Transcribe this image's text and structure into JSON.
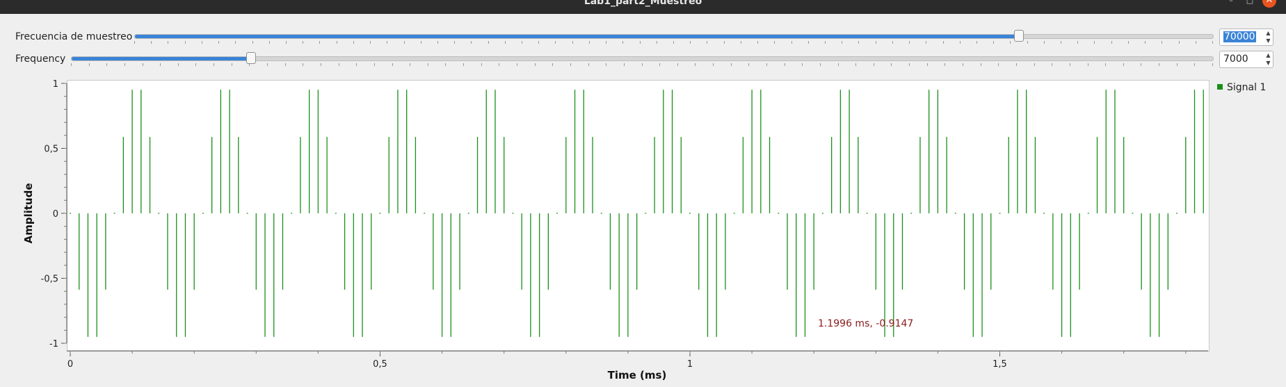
{
  "window": {
    "title": "Lab1_part2_Muestreo",
    "min_icon": "minimize-icon",
    "max_icon": "maximize-icon",
    "close_icon": "close-icon"
  },
  "controls": [
    {
      "label": "Frecuencia de muestreo",
      "value": "70000",
      "selected": true,
      "fraction": 0.82
    },
    {
      "label": "Frequency",
      "value": "7000",
      "selected": false,
      "fraction": 0.157
    }
  ],
  "legend": {
    "label": "Signal 1",
    "color": "#1a8f1a"
  },
  "cursor_readout": "1.1996 ms, -0.9147",
  "chart_data": {
    "type": "stem",
    "xlabel": "Time (ms)",
    "ylabel": "Amplitude",
    "xlim": [
      0,
      1.84
    ],
    "ylim": [
      -1,
      1
    ],
    "x_ticks": [
      {
        "v": 0,
        "label": "0"
      },
      {
        "v": 0.5,
        "label": "0,5"
      },
      {
        "v": 1,
        "label": "1"
      },
      {
        "v": 1.5,
        "label": "1,5"
      }
    ],
    "y_ticks": [
      {
        "v": 1,
        "label": "1"
      },
      {
        "v": 0.5,
        "label": "0,5"
      },
      {
        "v": 0,
        "label": "0"
      },
      {
        "v": -0.5,
        "label": "-0,5"
      },
      {
        "v": -1,
        "label": "-1"
      }
    ],
    "series": [
      {
        "color": "#1a8f1a",
        "sample_rate_hz": 70000,
        "signal_frequency_hz": 7000,
        "function": "sin",
        "amplitude": 1,
        "points": 129
      }
    ]
  }
}
